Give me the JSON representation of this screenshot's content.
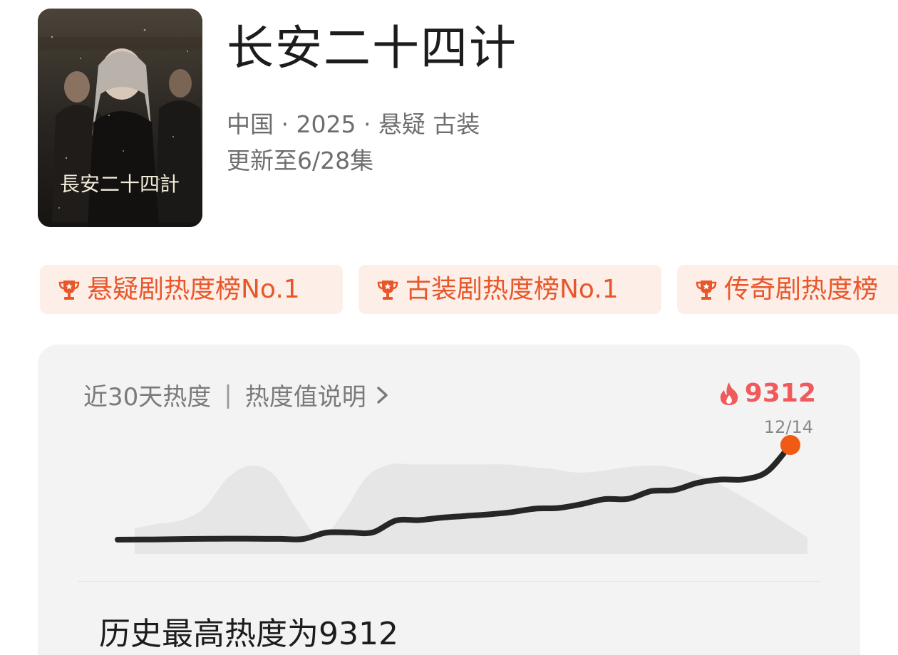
{
  "show": {
    "title": "长安二十四计",
    "meta_line": "中国 · 2025 · 悬疑 古装",
    "episode_status": "更新至6/28集",
    "poster_title": "長安二十四計"
  },
  "badges": [
    {
      "label": "悬疑剧热度榜No.1",
      "icon": "trophy-icon"
    },
    {
      "label": "古装剧热度榜No.1",
      "icon": "trophy-icon"
    },
    {
      "label": "传奇剧热度榜",
      "icon": "trophy-icon"
    }
  ],
  "heat_card": {
    "range_label": "近30天热度",
    "separator": "|",
    "help_link": "热度值说明",
    "current_value": "9312",
    "current_date": "12/14",
    "summary": "历史最高热度为9312"
  },
  "colors": {
    "accent": "#e8572a",
    "badge_bg": "#fdeee7",
    "hot_value": "#f05a5a",
    "endpoint": "#f05a14"
  },
  "chart_data": {
    "type": "line",
    "title": "",
    "xlabel": "",
    "ylabel": "",
    "last_point_label": "12/14",
    "last_point_value": 9312,
    "series": [
      {
        "values": [
          1000,
          1010,
          1030,
          1060,
          1080,
          1090,
          1075,
          1070,
          1060,
          1620,
          1630,
          1640,
          2680,
          2720,
          2940,
          3080,
          3220,
          3420,
          3720,
          3780,
          4120,
          4560,
          4580,
          5260,
          5360,
          5990,
          6280,
          6300,
          6980,
          9312
        ]
      }
    ],
    "background_series": [
      {
        "values": [
          2000,
          2400,
          2700,
          3800,
          6400,
          7500,
          6700,
          3600,
          1200,
          3400,
          6500,
          7600,
          7600,
          7600,
          7600,
          7600,
          7600,
          7400,
          7200,
          6900,
          7000,
          7300,
          7500,
          7400,
          6900,
          6100,
          5000,
          3800,
          2500,
          1200
        ]
      }
    ],
    "ylim": [
      0,
      10000
    ],
    "grid": false,
    "legend": "none"
  }
}
